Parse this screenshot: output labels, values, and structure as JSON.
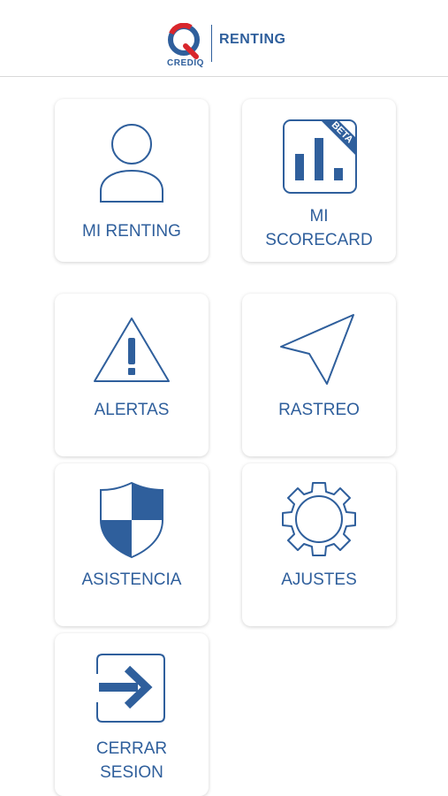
{
  "header": {
    "brand": "CREDIQ",
    "brand_letter": "Q",
    "title": "RENTING"
  },
  "colors": {
    "primary": "#2f5f9c",
    "accent_red": "#d9262c",
    "divider": "#d9d9d9"
  },
  "menu": {
    "mi_renting": {
      "label": "MI RENTING",
      "icon": "user-icon"
    },
    "mi_scorecard": {
      "label": "MI\nSCORECARD",
      "icon": "bar-chart-icon",
      "badge": "BETA"
    },
    "alertas": {
      "label": "ALERTAS",
      "icon": "warning-icon"
    },
    "rastreo": {
      "label": "RASTREO",
      "icon": "location-arrow-icon"
    },
    "asistencia": {
      "label": "ASISTENCIA",
      "icon": "shield-icon"
    },
    "ajustes": {
      "label": "AJUSTES",
      "icon": "gear-icon"
    },
    "cerrar_sesion": {
      "label": "CERRAR\nSESION",
      "icon": "exit-arrow-icon"
    }
  }
}
